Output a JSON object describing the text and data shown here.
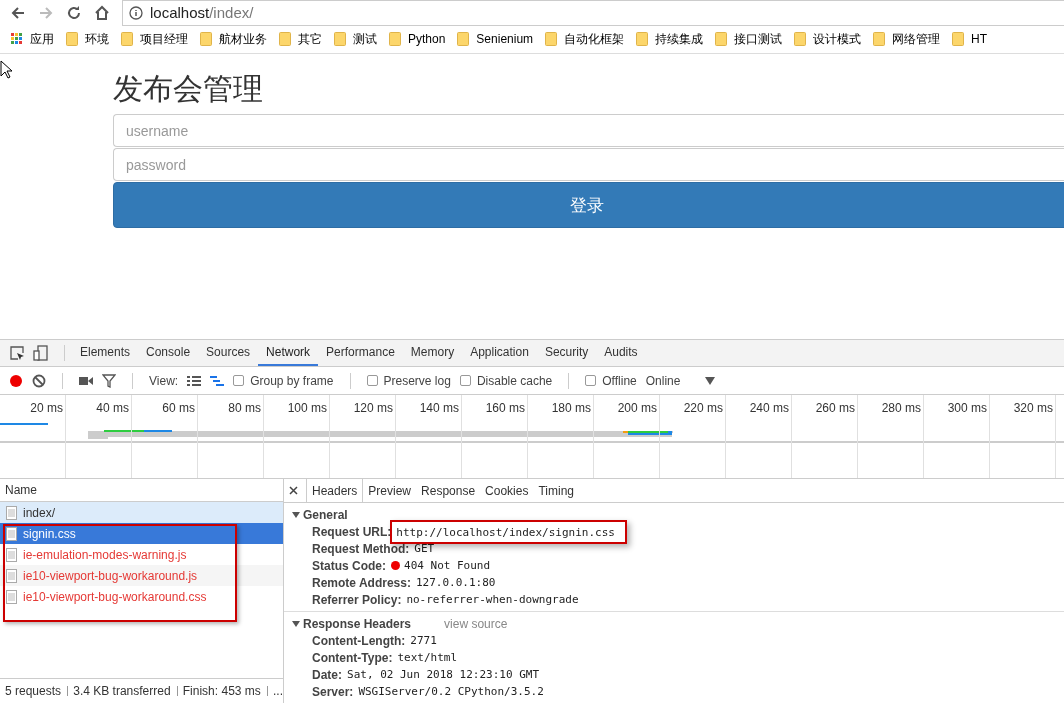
{
  "browser": {
    "url_host": "localhost",
    "url_path": "/index/"
  },
  "bookmarks": [
    {
      "kind": "apps",
      "label": "应用"
    },
    {
      "kind": "folder",
      "label": "环境"
    },
    {
      "kind": "folder",
      "label": "项目经理"
    },
    {
      "kind": "folder",
      "label": "航材业务"
    },
    {
      "kind": "folder",
      "label": "其它"
    },
    {
      "kind": "folder",
      "label": "测试"
    },
    {
      "kind": "folder",
      "label": "Python"
    },
    {
      "kind": "folder",
      "label": "Senienium"
    },
    {
      "kind": "folder",
      "label": "自动化框架"
    },
    {
      "kind": "folder",
      "label": "持续集成"
    },
    {
      "kind": "folder",
      "label": "接口测试"
    },
    {
      "kind": "folder",
      "label": "设计模式"
    },
    {
      "kind": "folder",
      "label": "网络管理"
    },
    {
      "kind": "folder",
      "label": "HT"
    }
  ],
  "page": {
    "title": "发布会管理",
    "username": {
      "placeholder": "username"
    },
    "password": {
      "placeholder": "password"
    },
    "login_button": "登录"
  },
  "devtools": {
    "tabs": [
      {
        "label": "Elements",
        "selected": false
      },
      {
        "label": "Console",
        "selected": false
      },
      {
        "label": "Sources",
        "selected": false
      },
      {
        "label": "Network",
        "selected": true
      },
      {
        "label": "Performance",
        "selected": false
      },
      {
        "label": "Memory",
        "selected": false
      },
      {
        "label": "Application",
        "selected": false
      },
      {
        "label": "Security",
        "selected": false
      },
      {
        "label": "Audits",
        "selected": false
      }
    ],
    "toolbar": {
      "recording": true,
      "view_label": "View:",
      "checkboxes": [
        {
          "label": "Group by frame",
          "checked": false
        },
        {
          "label": "Preserve log",
          "checked": false
        },
        {
          "label": "Disable cache",
          "checked": false
        },
        {
          "label": "Offline",
          "checked": false
        }
      ],
      "throttle": "Online"
    },
    "timeline_ticks": [
      "20 ms",
      "40 ms",
      "60 ms",
      "80 ms",
      "100 ms",
      "120 ms",
      "140 ms",
      "160 ms",
      "180 ms",
      "200 ms",
      "220 ms",
      "240 ms",
      "260 ms",
      "280 ms",
      "300 ms",
      "320 ms"
    ],
    "name_header": "Name",
    "requests": [
      {
        "name": "index/",
        "selected": false,
        "hovered": true,
        "failed": false
      },
      {
        "name": "signin.css",
        "selected": true,
        "hovered": false,
        "failed": true
      },
      {
        "name": "ie-emulation-modes-warning.js",
        "selected": false,
        "hovered": false,
        "failed": true
      },
      {
        "name": "ie10-viewport-bug-workaround.js",
        "selected": false,
        "hovered": false,
        "failed": true
      },
      {
        "name": "ie10-viewport-bug-workaround.css",
        "selected": false,
        "hovered": false,
        "failed": true
      }
    ],
    "status_bar": [
      "5 requests",
      "3.4 KB transferred",
      "Finish: 453 ms",
      "..."
    ],
    "detail_tabs": [
      {
        "label": "Headers",
        "selected": true
      },
      {
        "label": "Preview",
        "selected": false
      },
      {
        "label": "Response",
        "selected": false
      },
      {
        "label": "Cookies",
        "selected": false
      },
      {
        "label": "Timing",
        "selected": false
      }
    ],
    "sections": [
      {
        "title": "General",
        "expanded": true,
        "rows": [
          {
            "kind": "plain",
            "key": "Request URL:",
            "value": "http://localhost/index/signin.css"
          },
          {
            "kind": "plain",
            "key": "Request Method:",
            "value": "GET"
          },
          {
            "kind": "status",
            "key": "Status Code:",
            "value": "404 Not Found"
          },
          {
            "kind": "plain",
            "key": "Remote Address:",
            "value": "127.0.0.1:80"
          },
          {
            "kind": "plain",
            "key": "Referrer Policy:",
            "value": "no-referrer-when-downgrade"
          }
        ]
      },
      {
        "title": "Response Headers",
        "link": "view source",
        "expanded": true,
        "rows": [
          {
            "kind": "plain",
            "key": "Content-Length:",
            "value": "2771"
          },
          {
            "kind": "plain",
            "key": "Content-Type:",
            "value": "text/html"
          },
          {
            "kind": "plain",
            "key": "Date:",
            "value": "Sat, 02 Jun 2018 12:23:10 GMT"
          },
          {
            "kind": "plain",
            "key": "Server:",
            "value": "WSGIServer/0.2 CPython/3.5.2"
          }
        ]
      }
    ]
  }
}
